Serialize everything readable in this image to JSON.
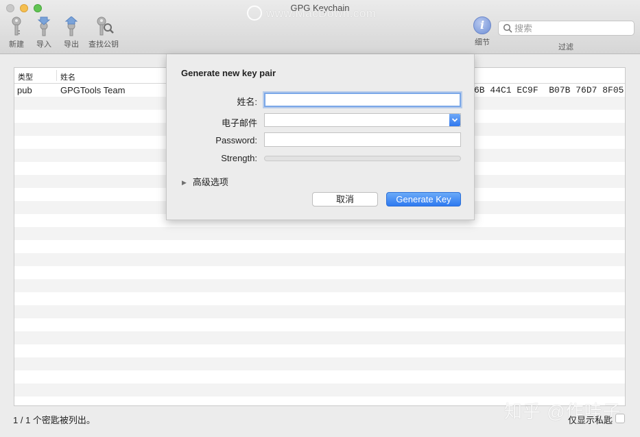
{
  "window": {
    "title": "GPG Keychain",
    "watermark": "www.MacDown.com",
    "traffic_lights": [
      "close",
      "minimize",
      "maximize"
    ]
  },
  "toolbar": {
    "new_label": "新建",
    "import_label": "导入",
    "export_label": "导出",
    "lookup_label": "查找公钥",
    "details_label": "细节",
    "filter_label": "过滤",
    "details_icon_glyph": "i",
    "search_placeholder": "搜索"
  },
  "table": {
    "columns": [
      "类型",
      "姓名"
    ],
    "rows": [
      {
        "type": "pub",
        "name": "GPGTools Team",
        "fingerprint": "6B 44C1 EC9F  B07B 76D7 8F05"
      }
    ]
  },
  "status_bar": {
    "count_text": "1 / 1 个密匙被列出。",
    "secret_only_label": "仅显示私匙",
    "secret_only_checked": false,
    "corner_watermark": "知乎 @作哇子"
  },
  "dialog": {
    "title": "Generate new key pair",
    "name_label": "姓名:",
    "name_value": "",
    "email_label": "电子邮件",
    "email_value": "",
    "password_label": "Password:",
    "password_value": "",
    "strength_label": "Strength:",
    "strength_fraction": 0,
    "advanced_label": "高级选项",
    "advanced_expanded": false,
    "cancel_label": "取消",
    "generate_label": "Generate Key"
  },
  "colors": {
    "accent": "#2e79f0",
    "focus_ring": "#7aa7e8",
    "close": "#c8c8c8",
    "minimize": "#f5bf4f",
    "maximize": "#61c454"
  }
}
